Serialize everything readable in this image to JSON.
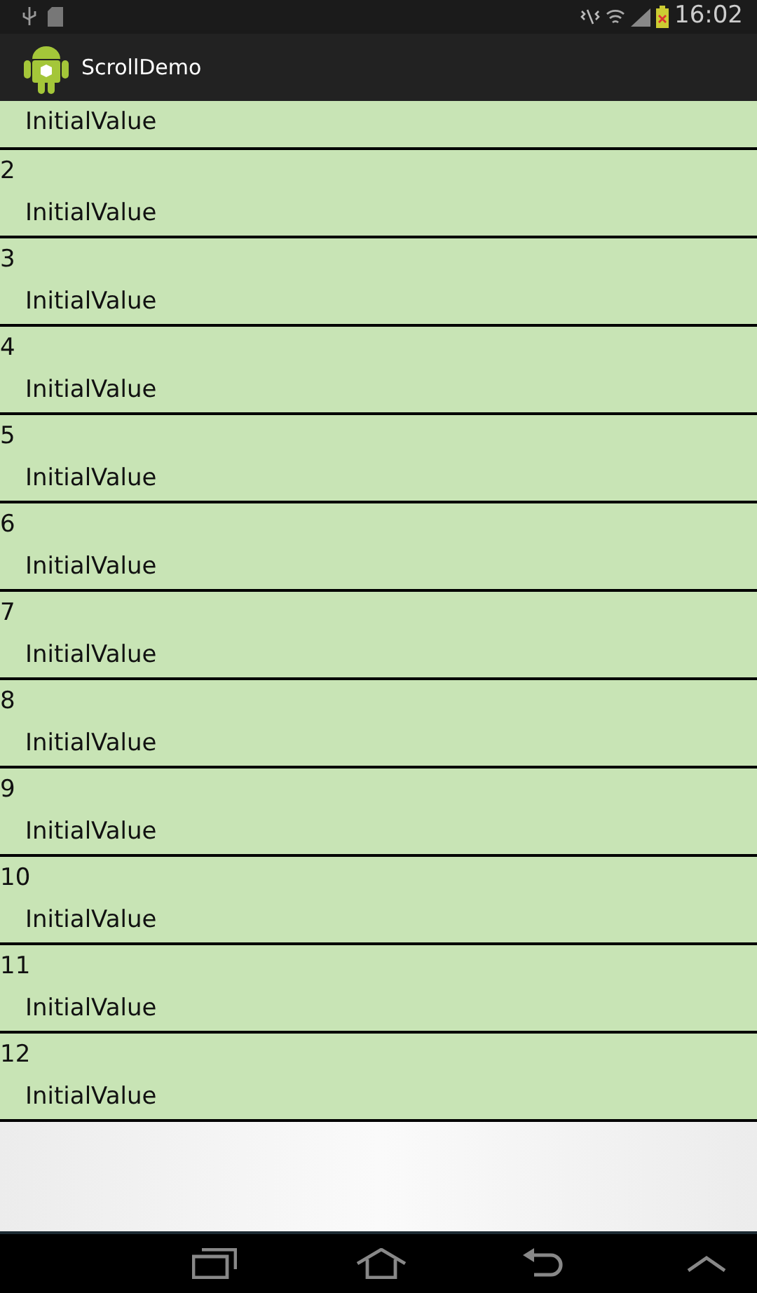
{
  "status_bar": {
    "time": "16:02"
  },
  "action_bar": {
    "title": "ScrollDemo"
  },
  "items": [
    {
      "value": "InitialValue"
    },
    {
      "number": "2",
      "value": "InitialValue"
    },
    {
      "number": "3",
      "value": "InitialValue"
    },
    {
      "number": "4",
      "value": "InitialValue"
    },
    {
      "number": "5",
      "value": "InitialValue"
    },
    {
      "number": "6",
      "value": "InitialValue"
    },
    {
      "number": "7",
      "value": "InitialValue"
    },
    {
      "number": "8",
      "value": "InitialValue"
    },
    {
      "number": "9",
      "value": "InitialValue"
    },
    {
      "number": "10",
      "value": "InitialValue"
    },
    {
      "number": "11",
      "value": "InitialValue"
    },
    {
      "number": "12",
      "value": "InitialValue"
    }
  ]
}
